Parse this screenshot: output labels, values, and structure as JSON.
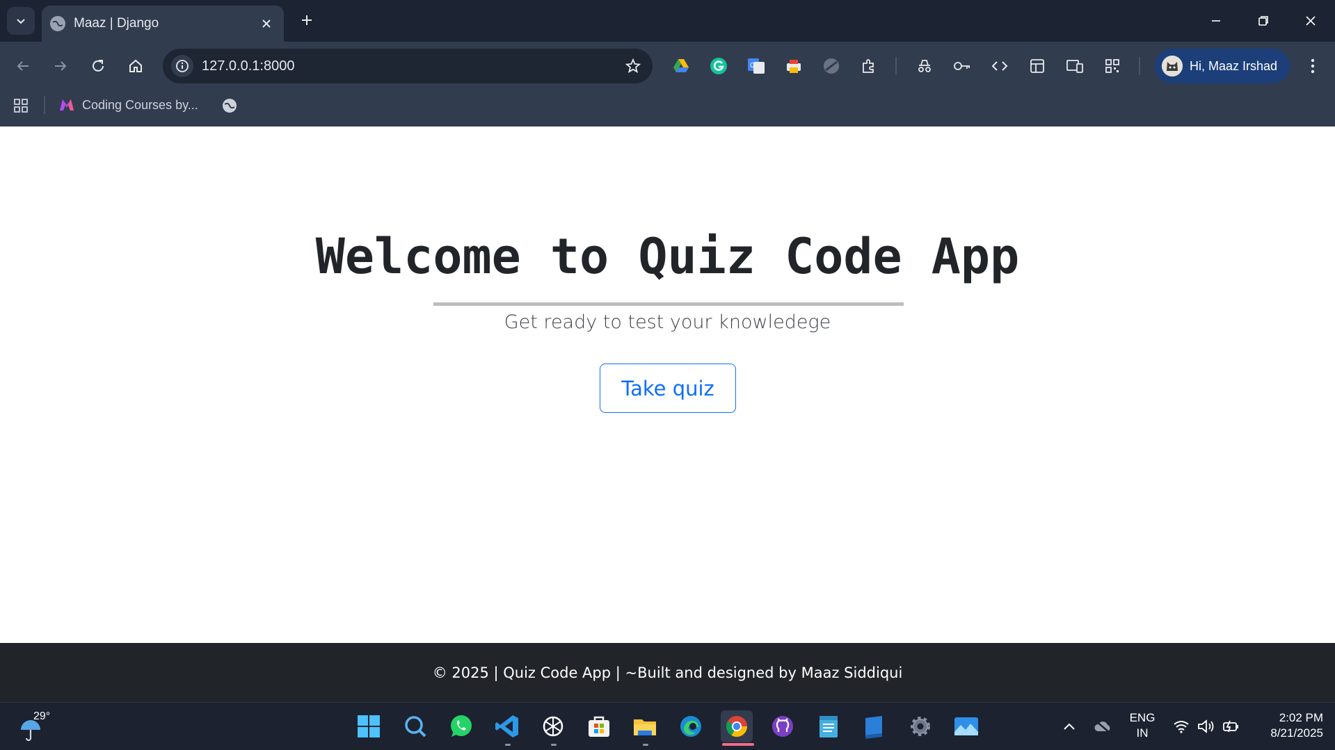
{
  "browser": {
    "tab": {
      "title": "Maaz | Django"
    },
    "url": "127.0.0.1:8000",
    "profile": {
      "label": "Hi, Maaz Irshad"
    },
    "bookmarks": [
      {
        "label": "Coding Courses by..."
      }
    ]
  },
  "page": {
    "title": "Welcome to Quiz Code App",
    "subtitle": "Get ready to test your knowledege",
    "cta_label": "Take quiz",
    "footer": "© 2025 | Quiz Code App | ~Built and designed by Maaz Siddiqui"
  },
  "taskbar": {
    "weather_temp": "29°",
    "lang_line1": "ENG",
    "lang_line2": "IN",
    "time": "2:02 PM",
    "date": "8/21/2025"
  },
  "colors": {
    "accent": "#0d6efd",
    "footer_bg": "#212529",
    "browser_frame": "#323c4f"
  }
}
